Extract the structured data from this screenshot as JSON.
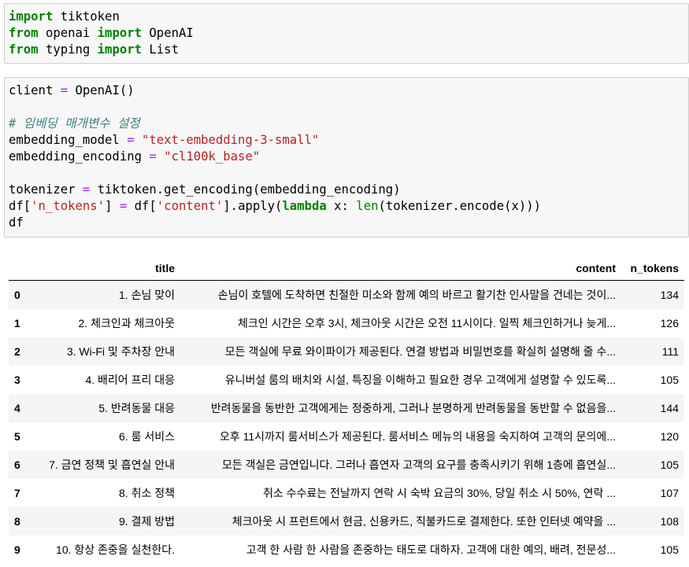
{
  "cells": {
    "cell1": {
      "lines": [
        [
          "import",
          " tiktoken"
        ],
        [
          "from",
          " openai ",
          "import",
          " OpenAI"
        ],
        [
          "from",
          " typing ",
          "import",
          " List"
        ]
      ]
    },
    "cell2": {
      "l1_a": "client ",
      "l1_op": "=",
      "l1_b": " OpenAI()",
      "comment": "# 임베딩 매개변수 설정",
      "l3_a": "embedding_model ",
      "l3_op": "=",
      "l3_str": " \"text-embedding-3-small\"",
      "l4_a": "embedding_encoding ",
      "l4_op": "=",
      "l4_str": " \"cl100k_base\"",
      "l6_a": "tokenizer ",
      "l6_op": "=",
      "l6_b": " tiktoken.get_encoding(embedding_encoding)",
      "l7_a": "df[",
      "l7_s1": "'n_tokens'",
      "l7_b": "] ",
      "l7_op": "=",
      "l7_c": " df[",
      "l7_s2": "'content'",
      "l7_d": "].apply(",
      "l7_kw": "lambda",
      "l7_e": " x: ",
      "l7_bi": "len",
      "l7_f": "(tokenizer.encode(x)))",
      "l8": "df"
    }
  },
  "table": {
    "columns": [
      "",
      "title",
      "content",
      "n_tokens"
    ],
    "rows": [
      {
        "idx": "0",
        "title": "1. 손님 맞이",
        "content": "손님이 호텔에 도착하면 친절한 미소와 함께 예의 바르고 활기찬 인사말을 건네는 것이...",
        "n_tokens": "134"
      },
      {
        "idx": "1",
        "title": "2. 체크인과 체크아웃",
        "content": "체크인 시간은 오후 3시, 체크아웃 시간은 오전 11시이다. 일찍 체크인하거나 늦게...",
        "n_tokens": "126"
      },
      {
        "idx": "2",
        "title": "3. Wi-Fi 및 주차장 안내",
        "content": "모든 객실에 무료 와이파이가 제공된다. 연결 방법과 비밀번호를 확실히 설명해 줄 수...",
        "n_tokens": "111"
      },
      {
        "idx": "3",
        "title": "4. 배리어 프리 대응",
        "content": "유니버설 룸의 배치와 시설, 특징을 이해하고 필요한 경우 고객에게 설명할 수 있도록...",
        "n_tokens": "105"
      },
      {
        "idx": "4",
        "title": "5. 반려동물 대응",
        "content": "반려동물을 동반한 고객에게는 정중하게, 그러나 분명하게 반려동물을 동반할 수 없음을...",
        "n_tokens": "144"
      },
      {
        "idx": "5",
        "title": "6. 룸 서비스",
        "content": "오후 11시까지 룸서비스가 제공된다. 룸서비스 메뉴의 내용을 숙지하여 고객의 문의에...",
        "n_tokens": "120"
      },
      {
        "idx": "6",
        "title": "7. 금연 정책 및 흡연실 안내",
        "content": "모든 객실은 금연입니다. 그러나 흡연자 고객의 요구를 충족시키기 위해 1층에 흡연실...",
        "n_tokens": "105"
      },
      {
        "idx": "7",
        "title": "8. 취소 정책",
        "content": "취소 수수료는 전날까지 연락 시 숙박 요금의 30%, 당일 취소 시 50%, 연락 ...",
        "n_tokens": "107"
      },
      {
        "idx": "8",
        "title": "9. 결제 방법",
        "content": "체크아웃 시 프런트에서 현금, 신용카드, 직불카드로 결제한다. 또한 인터넷 예약을 ...",
        "n_tokens": "108"
      },
      {
        "idx": "9",
        "title": "10. 항상 존중을 실천한다.",
        "content": "고객 한 사람 한 사람을 존중하는 태도로 대하자. 고객에 대한 예의, 배려, 전문성...",
        "n_tokens": "105"
      }
    ]
  }
}
